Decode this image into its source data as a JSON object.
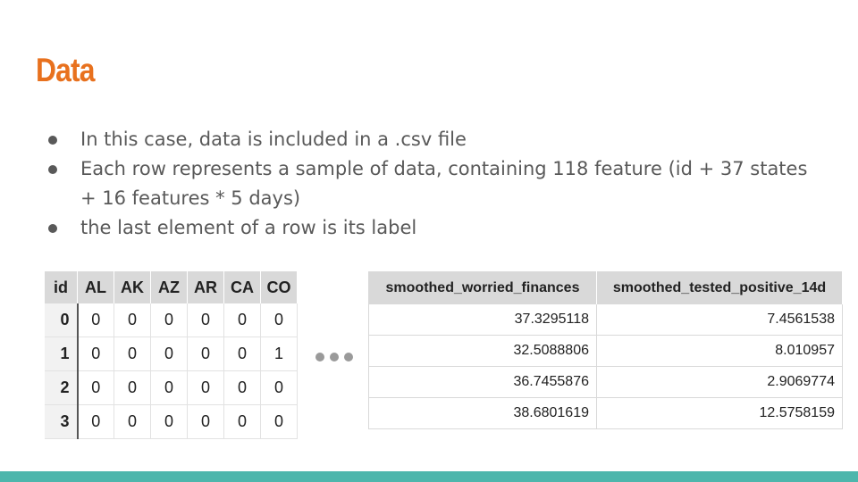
{
  "slide": {
    "title": "Data",
    "bullets": [
      "In this case, data is included in a .csv file",
      "Each row represents a sample of data, containing 118 feature (id + 37 states + 16 features * 5 days)",
      "the last element of a row is its label"
    ]
  },
  "left_table": {
    "headers": [
      "id",
      "AL",
      "AK",
      "AZ",
      "AR",
      "CA",
      "CO"
    ],
    "rows": [
      [
        "0",
        "0",
        "0",
        "0",
        "0",
        "0",
        "0"
      ],
      [
        "1",
        "0",
        "0",
        "0",
        "0",
        "0",
        "1"
      ],
      [
        "2",
        "0",
        "0",
        "0",
        "0",
        "0",
        "0"
      ],
      [
        "3",
        "0",
        "0",
        "0",
        "0",
        "0",
        "0"
      ]
    ]
  },
  "right_table": {
    "headers": [
      "smoothed_worried_finances",
      "smoothed_tested_positive_14d"
    ],
    "rows": [
      [
        "37.3295118",
        "7.4561538"
      ],
      [
        "32.5088806",
        "8.010957"
      ],
      [
        "36.7455876",
        "2.9069774"
      ],
      [
        "38.6801619",
        "12.5758159"
      ]
    ]
  },
  "colors": {
    "title": "#e8711e",
    "body_text": "#595959",
    "footer_bar": "#4db6ac",
    "header_fill": "#d9d9d9"
  }
}
